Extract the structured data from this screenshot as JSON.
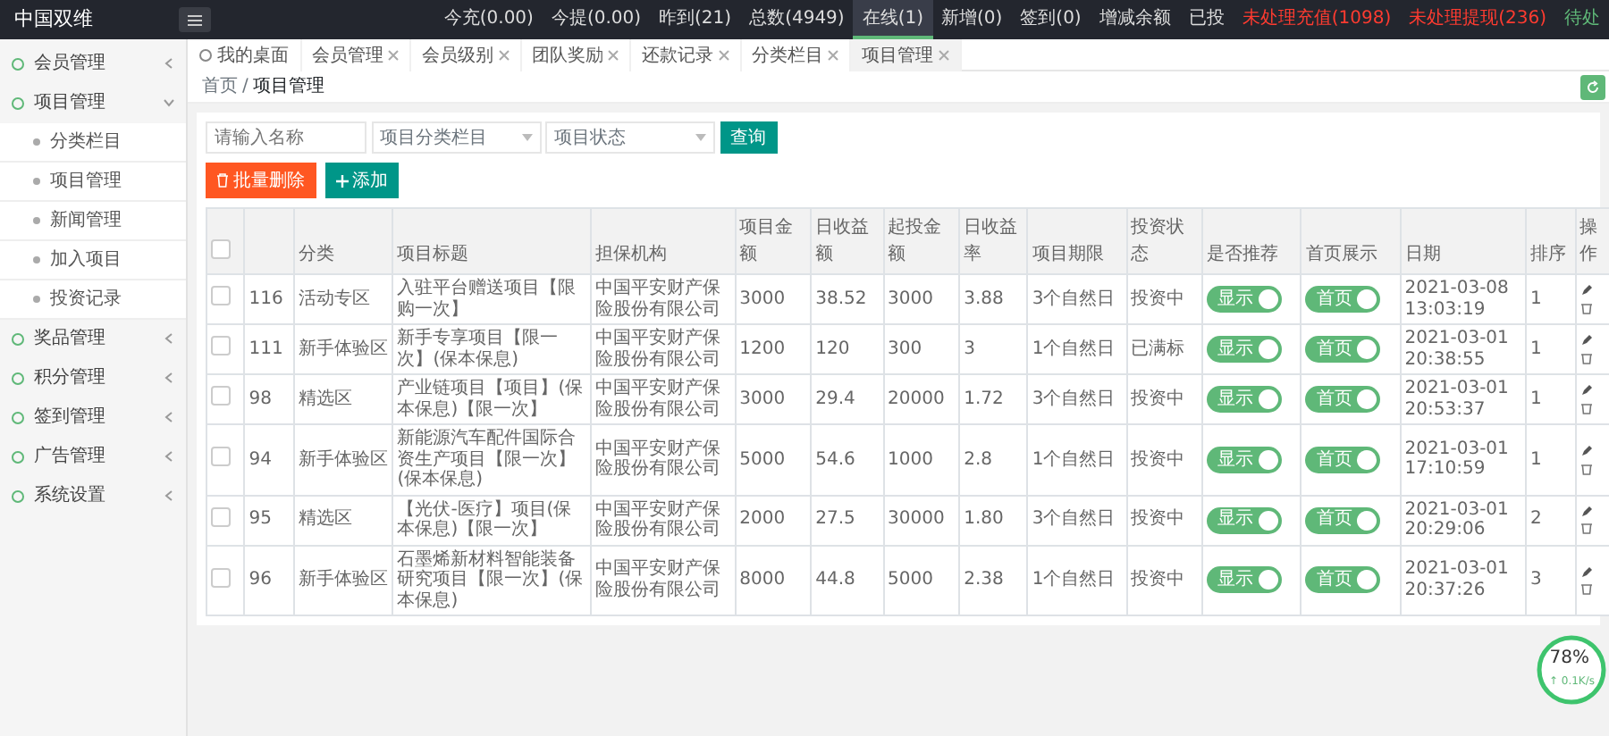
{
  "topbar": {
    "logo": "中国双维",
    "stats": [
      {
        "label": "今充(0.00)",
        "selected": false,
        "kind": "plain"
      },
      {
        "label": "今提(0.00)",
        "selected": false,
        "kind": "plain"
      },
      {
        "label": "昨到(21)",
        "selected": false,
        "kind": "plain"
      },
      {
        "label": "总数(4949)",
        "selected": false,
        "kind": "plain"
      },
      {
        "label": "在线(1)",
        "selected": true,
        "kind": "plain"
      },
      {
        "label": "新增(0)",
        "selected": false,
        "kind": "plain"
      },
      {
        "label": "签到(0)",
        "selected": false,
        "kind": "plain"
      },
      {
        "label": "增减余额",
        "selected": false,
        "kind": "plain"
      },
      {
        "label": "已投",
        "selected": false,
        "kind": "plain"
      },
      {
        "label": "未处理充值(1098)",
        "selected": false,
        "kind": "alert"
      },
      {
        "label": "未处理提现(236)",
        "selected": false,
        "kind": "alert"
      },
      {
        "label": "待处",
        "selected": false,
        "kind": "success"
      }
    ]
  },
  "sidebar": {
    "items": [
      {
        "label": "会员管理",
        "expanded": false
      },
      {
        "label": "项目管理",
        "expanded": true,
        "children": [
          {
            "label": "分类栏目"
          },
          {
            "label": "项目管理"
          },
          {
            "label": "新闻管理"
          },
          {
            "label": "加入项目"
          },
          {
            "label": "投资记录"
          }
        ]
      },
      {
        "label": "奖品管理",
        "expanded": false
      },
      {
        "label": "积分管理",
        "expanded": false
      },
      {
        "label": "签到管理",
        "expanded": false
      },
      {
        "label": "广告管理",
        "expanded": false
      },
      {
        "label": "系统设置",
        "expanded": false
      }
    ]
  },
  "tabs": [
    {
      "label": "我的桌面",
      "selected": false,
      "kind": "home"
    },
    {
      "label": "会员管理",
      "selected": false,
      "kind": "closable"
    },
    {
      "label": "会员级别",
      "selected": false,
      "kind": "closable"
    },
    {
      "label": "团队奖励",
      "selected": false,
      "kind": "closable"
    },
    {
      "label": "还款记录",
      "selected": false,
      "kind": "closable"
    },
    {
      "label": "分类栏目",
      "selected": false,
      "kind": "closable"
    },
    {
      "label": "项目管理",
      "selected": true,
      "kind": "closable"
    }
  ],
  "breadcrumb": {
    "items": [
      "首页",
      "项目管理"
    ],
    "separator": "/"
  },
  "filters": {
    "name": {
      "placeholder": "请输入名称"
    },
    "category": {
      "placeholder": "项目分类栏目"
    },
    "status": {
      "placeholder": "项目状态"
    },
    "search_button": "查询"
  },
  "actions": {
    "delete_button": "批量删除",
    "add_button": "添加"
  },
  "table": {
    "header_checked": false,
    "columns": [
      "",
      "分类",
      "项目标题",
      "担保机构",
      "项目金额",
      "日收益额",
      "起投金额",
      "日收益率",
      "项目期限",
      "投资状态",
      "是否推荐",
      "首页展示",
      "日期",
      "排序",
      "操作"
    ],
    "rows": [
      {
        "checked": false,
        "id": "116",
        "category": "活动专区",
        "title": "入驻平台赠送项目【限购一次】",
        "guarantor": "中国平安财产保险股份有限公司",
        "amount": "3000",
        "income": "38.52",
        "min": "3000",
        "rate": "3.88",
        "term": "3个自然日",
        "status": "投资中",
        "recommend": {
          "label": "显示",
          "on": true
        },
        "home": {
          "label": "首页",
          "on": true
        },
        "date": "2021-03-08 13:03:19",
        "sort": "1"
      },
      {
        "checked": false,
        "id": "111",
        "category": "新手体验区",
        "title": "新手专享项目【限一次】(保本保息)",
        "guarantor": "中国平安财产保险股份有限公司",
        "amount": "1200",
        "income": "120",
        "min": "300",
        "rate": "3",
        "term": "1个自然日",
        "status": "已满标",
        "recommend": {
          "label": "显示",
          "on": true
        },
        "home": {
          "label": "首页",
          "on": true
        },
        "date": "2021-03-01 20:38:55",
        "sort": "1"
      },
      {
        "checked": false,
        "id": "98",
        "category": "精选区",
        "title": "产业链项目【项目】(保本保息)【限一次】",
        "guarantor": "中国平安财产保险股份有限公司",
        "amount": "3000",
        "income": "29.4",
        "min": "20000",
        "rate": "1.72",
        "term": "3个自然日",
        "status": "投资中",
        "recommend": {
          "label": "显示",
          "on": true
        },
        "home": {
          "label": "首页",
          "on": true
        },
        "date": "2021-03-01 20:53:37",
        "sort": "1"
      },
      {
        "checked": false,
        "id": "94",
        "category": "新手体验区",
        "title": "新能源汽车配件国际合资生产项目【限一次】(保本保息)",
        "guarantor": "中国平安财产保险股份有限公司",
        "amount": "5000",
        "income": "54.6",
        "min": "1000",
        "rate": "2.8",
        "term": "1个自然日",
        "status": "投资中",
        "recommend": {
          "label": "显示",
          "on": true
        },
        "home": {
          "label": "首页",
          "on": true
        },
        "date": "2021-03-01 17:10:59",
        "sort": "1"
      },
      {
        "checked": false,
        "id": "95",
        "category": "精选区",
        "title": "【光伏-医疗】项目(保本保息)【限一次】",
        "guarantor": "中国平安财产保险股份有限公司",
        "amount": "2000",
        "income": "27.5",
        "min": "30000",
        "rate": "1.80",
        "term": "3个自然日",
        "status": "投资中",
        "recommend": {
          "label": "显示",
          "on": true
        },
        "home": {
          "label": "首页",
          "on": true
        },
        "date": "2021-03-01 20:29:06",
        "sort": "2"
      },
      {
        "checked": false,
        "id": "96",
        "category": "新手体验区",
        "title": "石墨烯新材料智能装备研究项目【限一次】(保本保息)",
        "guarantor": "中国平安财产保险股份有限公司",
        "amount": "8000",
        "income": "44.8",
        "min": "5000",
        "rate": "2.38",
        "term": "1个自然日",
        "status": "投资中",
        "recommend": {
          "label": "显示",
          "on": true
        },
        "home": {
          "label": "首页",
          "on": true
        },
        "date": "2021-03-01 20:37:26",
        "sort": "3"
      }
    ]
  },
  "speed_widget": {
    "percent": "78%",
    "rate": "↑ 0.1K/s"
  }
}
